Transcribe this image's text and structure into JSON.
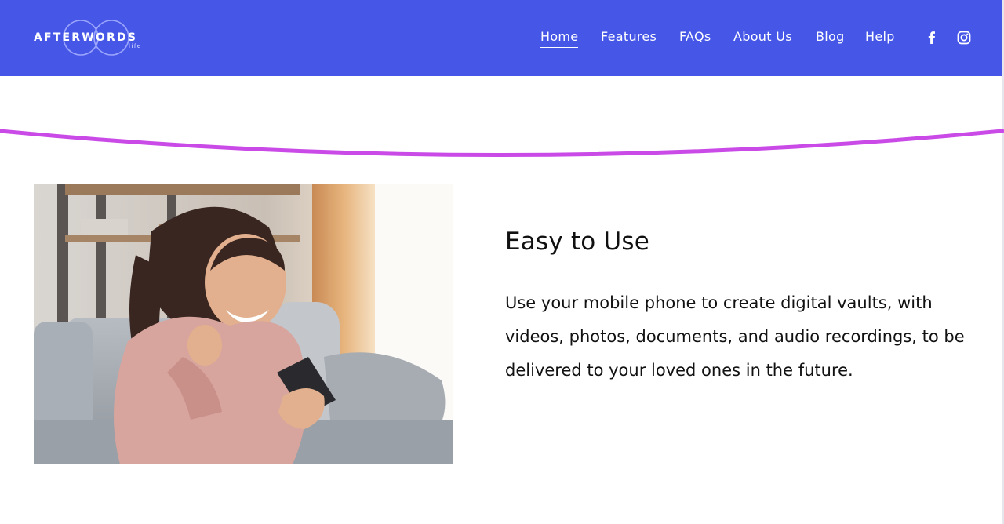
{
  "brand": {
    "name": "AFTERWORDS",
    "suffix": "life"
  },
  "nav": {
    "items": [
      {
        "label": "Home",
        "active": true
      },
      {
        "label": "Features",
        "active": false
      },
      {
        "label": "FAQs",
        "active": false
      },
      {
        "label": "About Us",
        "active": false
      },
      {
        "label": "Blog",
        "active": false
      },
      {
        "label": "Help",
        "active": false
      }
    ],
    "social": [
      "facebook-icon",
      "instagram-icon"
    ]
  },
  "colors": {
    "header": "#4657e8",
    "accent_wave": "#c94ae6",
    "text": "#111111"
  },
  "feature": {
    "title": "Easy to Use",
    "description": "Use your mobile phone to create digital vaults, with videos, photos, documents, and audio recordings, to be delivered to your loved ones in the future.",
    "image": "woman-smiling-at-phone-on-sofa"
  }
}
